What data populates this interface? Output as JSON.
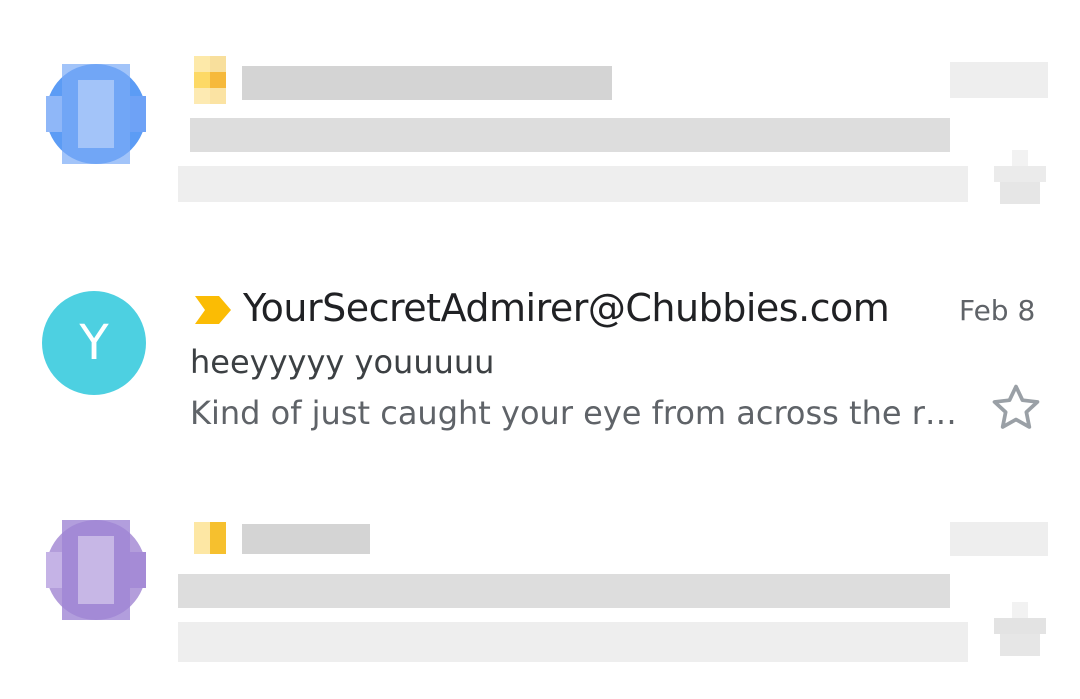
{
  "colors": {
    "avatar_cyan": "#4dd0e1",
    "important_yellow": "#fbbc04",
    "star_outline": "#9aa0a6",
    "sender_text": "#202124",
    "subject_text": "#3c4043",
    "muted_text": "#5f6368"
  },
  "messages": [
    {
      "state": "obscured",
      "avatar_color": "#4285f4"
    },
    {
      "state": "visible",
      "avatar_letter": "Y",
      "important_icon": "important-marker-icon",
      "sender": "YourSecretAdmirer@Chubbies.com",
      "date": "Feb 8",
      "subject": "heeyyyyy youuuuu",
      "snippet": "Kind of just caught your eye from across the r…",
      "star_icon": "star-outline-icon",
      "starred": false
    },
    {
      "state": "obscured",
      "avatar_color": "#9575cd"
    }
  ]
}
